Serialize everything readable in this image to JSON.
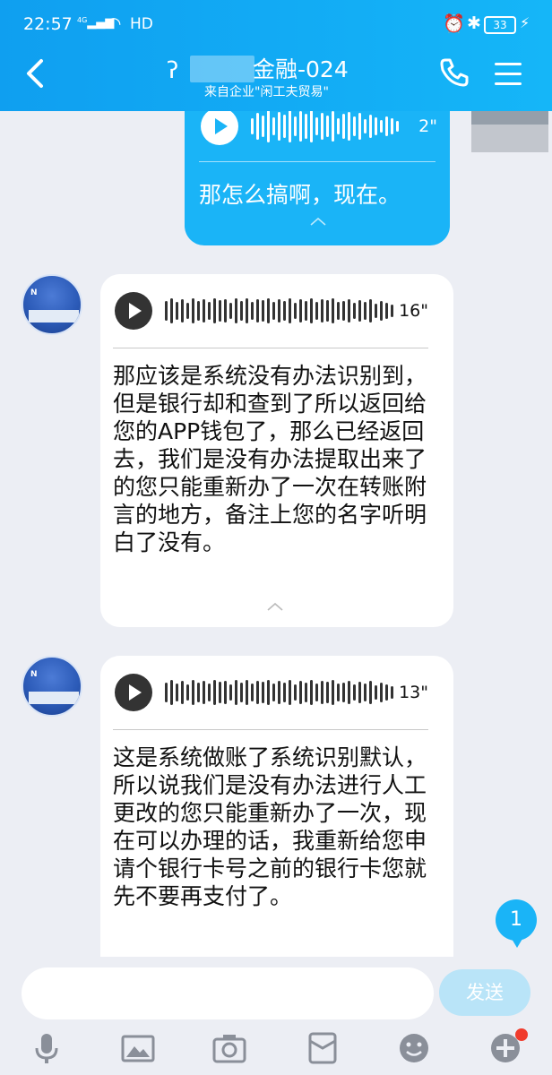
{
  "status_bar": {
    "time": "22:57",
    "signal": "4G",
    "network": "HD",
    "battery": "33"
  },
  "header": {
    "title": "金融-024",
    "subtitle": "来自企业\"闲工夫贸易\""
  },
  "messages": [
    {
      "sender": "self",
      "type": "voice",
      "duration": "2\"",
      "text": "那怎么搞啊，现在。"
    },
    {
      "sender": "contact",
      "type": "voice",
      "duration": "16\"",
      "text": "那应该是系统没有办法识别到，但是银行却和查到了所以返回给您的APP钱包了，那么已经返回去，我们是没有办法提取出来了的您只能重新办了一次在转账附言的地方，备注上您的名字听明白了没有。"
    },
    {
      "sender": "contact",
      "type": "voice",
      "duration": "13\"",
      "text": "这是系统做账了系统识别默认，所以说我们是没有办法进行人工更改的您只能重新办了一次，现在可以办理的话，我重新给您申请个银行卡号之前的银行卡您就先不要再支付了。"
    }
  ],
  "unread_count": "1",
  "input": {
    "value": "",
    "send_label": "发送"
  },
  "colors": {
    "header": "#15aef6",
    "bubble_self": "#1ab4f7",
    "bubble_other": "#ffffff",
    "background": "#eceef4"
  },
  "toolbar_icons": [
    "microphone-icon",
    "image-icon",
    "camera-icon",
    "red-packet-icon",
    "emoji-icon",
    "plus-icon"
  ]
}
